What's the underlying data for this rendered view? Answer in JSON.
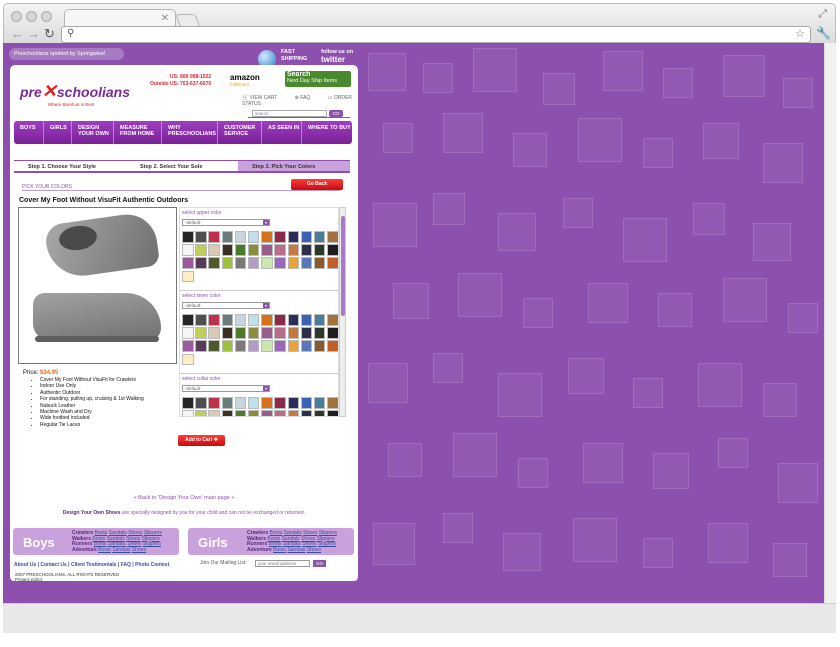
{
  "browser": {
    "url": ""
  },
  "top": {
    "spotted": "Preschoolians spotted by Springwise!",
    "fast_shipping": [
      "FAST",
      "SHIPPING"
    ],
    "twitter": [
      "follow us on",
      "twitter"
    ]
  },
  "header": {
    "logo_pre": "pre",
    "logo_schoolians": "schoolians",
    "tagline": "Where Barefoot is Best",
    "phone_us": "US: 800-998-1522",
    "phone_outside": "Outside US: 703-637-6070",
    "amazon": "amazon",
    "amazon_sub": "fulfillment",
    "search_banner": [
      "Search",
      "Next Day Ship Items"
    ],
    "view_cart": "VIEW CART",
    "faq": "FAQ",
    "order_status": "ORDER STATUS",
    "search_placeholder": "search",
    "search_go": "GO"
  },
  "nav": [
    {
      "label": "BOYS"
    },
    {
      "label": "GIRLS"
    },
    {
      "label": "DESIGN YOUR OWN"
    },
    {
      "label": "MEASURE FROM HOME"
    },
    {
      "label": "WHY PRESCHOOLIANS"
    },
    {
      "label": "CUSTOMER SERVICE"
    },
    {
      "label": "AS SEEN IN"
    },
    {
      "label": "WHERE TO BUY"
    }
  ],
  "steps": [
    "Step 1. Choose Your Style",
    "Step 2. Select Your Sole",
    "Step 3. Pick Your Colors"
  ],
  "pick_colors": "PICK YOUR COLORS",
  "go_back": "Go Back",
  "product": {
    "title": "Cover My Foot Without VisuFit Authentic Outdoors",
    "price_label": "Price:",
    "price": "$34.95",
    "features": [
      "Cover My Foot Without VisuFit for Crawlers",
      "Indoor Use Only",
      "Authentic Outdoor",
      "For standing, pulling up, cruising & 1st Walking",
      "Nubuck Leather",
      "Machine Wash and Dry",
      "Wide footbed included",
      "Regular Tie Laces"
    ],
    "add_to_cart": "Add to Cart"
  },
  "color_groups": [
    {
      "label": "select upper color",
      "default": "-default-"
    },
    {
      "label": "select lower color",
      "default": "-default-"
    },
    {
      "label": "select collar color",
      "default": "-default-"
    }
  ],
  "swatches": [
    "#262626",
    "#4f4f4f",
    "#c0304a",
    "#6a7d7d",
    "#c8d4de",
    "#bfe0eb",
    "#d7701c",
    "#8e2a49",
    "#2d2d5c",
    "#3a63b3",
    "#4a7d9a",
    "#a07340",
    "#f5f5f5",
    "#bfcd5a",
    "#d9c9b5",
    "#3a2f22",
    "#4b7a2d",
    "#8a8d3a",
    "#9a5c8b",
    "#b86e8a",
    "#c37a3e",
    "#2b2f4a",
    "#2a3a2a",
    "#1e1e1e",
    "#9b5a9e",
    "#5a3a5a",
    "#4e5a2a",
    "#9dc23a",
    "#7a7a7a",
    "#b39cc9",
    "#cde5ae",
    "#9966b8",
    "#e8a33a",
    "#5a77b8",
    "#8a5a2a",
    "#c06028",
    "#ffeec0"
  ],
  "back_link": "« Back to 'Design Your Own' main page »",
  "disclaimer_bold": "Design Your Own Shoes",
  "disclaimer_rest": " are specially designed by you for your child and can not be exchanged or returned.",
  "footer": {
    "boys": "Boys",
    "girls": "Girls",
    "rows": [
      {
        "stage": "Crawlers",
        "items": [
          "Boots",
          "Sandals",
          "Shoes",
          "Slippers"
        ]
      },
      {
        "stage": "Walkers",
        "items": [
          "Boots",
          "Sandals",
          "Shoes",
          "Slippers"
        ]
      },
      {
        "stage": "Runners",
        "items": [
          "Boots",
          "Sandals",
          "Shoes",
          "Slippers"
        ]
      },
      {
        "stage": "Adventure",
        "items": [
          "Boots",
          "Sandals",
          "Shoes"
        ]
      }
    ],
    "links": "About Us | Contact Us | Client Testimonials | FAQ | Photo Contest",
    "mailing": "Join Our Mailing List:",
    "email_placeholder": "your email address",
    "go": "GO",
    "copyright": "2007 PRESCHOOLIANS. ALL RIGHTS RESERVED",
    "privacy": "Privacy policy"
  },
  "colors": {
    "brand": "#8e50ae",
    "accent": "#e2212b"
  }
}
